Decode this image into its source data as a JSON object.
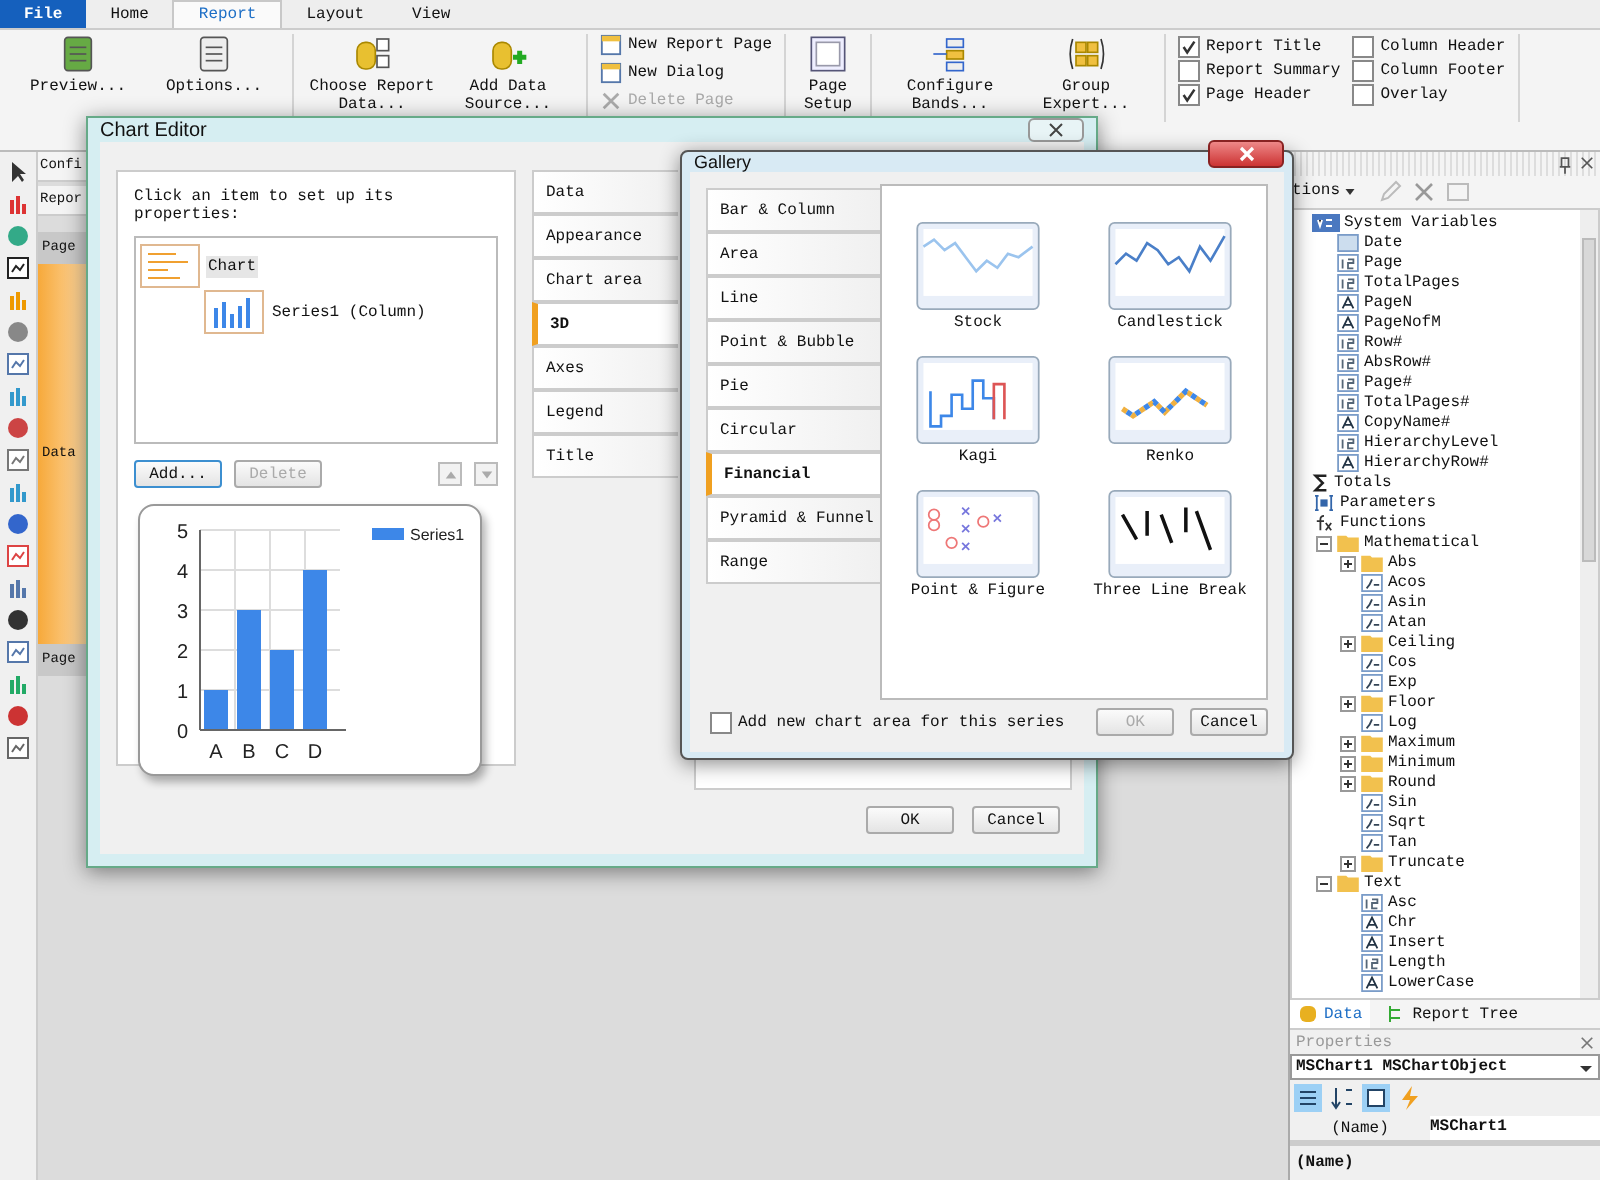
{
  "menu_tabs": [
    {
      "label": "File",
      "kind": "file",
      "selected": false
    },
    {
      "label": "Home",
      "kind": "tab",
      "selected": false
    },
    {
      "label": "Report",
      "kind": "tab",
      "selected": true
    },
    {
      "label": "Layout",
      "kind": "tab",
      "selected": false
    },
    {
      "label": "View",
      "kind": "tab",
      "selected": false
    }
  ],
  "ribbon": [
    {
      "kind": "large",
      "buttons": [
        {
          "label": "Preview...",
          "disabled": false
        },
        {
          "label": "Options...",
          "disabled": false
        }
      ]
    },
    {
      "kind": "large",
      "buttons": [
        {
          "label": "Choose Report Data...",
          "disabled": false
        },
        {
          "label": "Add Data Source...",
          "disabled": false
        }
      ]
    },
    {
      "kind": "small",
      "buttons": [
        {
          "label": "New Report Page",
          "disabled": false
        },
        {
          "label": "New Dialog",
          "disabled": false
        },
        {
          "label": "Delete Page",
          "disabled": true
        }
      ]
    },
    {
      "kind": "large",
      "buttons": [
        {
          "label": "Page Setup",
          "disabled": false
        }
      ]
    },
    {
      "kind": "large",
      "buttons": [
        {
          "label": "Configure Bands...",
          "disabled": false
        },
        {
          "label": "Group Expert...",
          "disabled": false
        }
      ]
    },
    {
      "kind": "checks",
      "buttons": [
        {
          "label": "Report Title",
          "checked": true
        },
        {
          "label": "Report Summary",
          "checked": false
        },
        {
          "label": "Page Header",
          "checked": true
        },
        {
          "label": "Column Header",
          "checked": false
        },
        {
          "label": "Column Footer",
          "checked": false
        },
        {
          "label": "Overlay",
          "checked": false
        }
      ]
    }
  ],
  "designer_tabs": [
    "Confi",
    "Repor"
  ],
  "bands": [
    {
      "label": "Page",
      "kind": "header"
    },
    {
      "label": "Data",
      "kind": "data"
    },
    {
      "label": "Page",
      "kind": "footer"
    }
  ],
  "data_panel": {
    "toolbar_label": "tions",
    "tree": [
      {
        "label": "System Variables",
        "kind": "sysvars",
        "children": [
          {
            "label": "Date",
            "kind": "date"
          },
          {
            "label": "Page",
            "kind": "number"
          },
          {
            "label": "TotalPages",
            "kind": "number"
          },
          {
            "label": "PageN",
            "kind": "text"
          },
          {
            "label": "PageNofM",
            "kind": "text"
          },
          {
            "label": "Row#",
            "kind": "number"
          },
          {
            "label": "AbsRow#",
            "kind": "number"
          },
          {
            "label": "Page#",
            "kind": "number"
          },
          {
            "label": "TotalPages#",
            "kind": "number"
          },
          {
            "label": "CopyName#",
            "kind": "text"
          },
          {
            "label": "HierarchyLevel",
            "kind": "number"
          },
          {
            "label": "HierarchyRow#",
            "kind": "text"
          }
        ]
      },
      {
        "label": "Totals",
        "kind": "totals"
      },
      {
        "label": "Parameters",
        "kind": "parameters"
      },
      {
        "label": "Functions",
        "kind": "functions",
        "children": [
          {
            "label": "Mathematical",
            "kind": "folder",
            "expanded": true,
            "children": [
              {
                "label": "Abs",
                "kind": "folder",
                "expanded": false
              },
              {
                "label": "Acos",
                "kind": "function"
              },
              {
                "label": "Asin",
                "kind": "function"
              },
              {
                "label": "Atan",
                "kind": "function"
              },
              {
                "label": "Ceiling",
                "kind": "folder",
                "expanded": false
              },
              {
                "label": "Cos",
                "kind": "function"
              },
              {
                "label": "Exp",
                "kind": "function"
              },
              {
                "label": "Floor",
                "kind": "folder",
                "expanded": false
              },
              {
                "label": "Log",
                "kind": "function"
              },
              {
                "label": "Maximum",
                "kind": "folder",
                "expanded": false
              },
              {
                "label": "Minimum",
                "kind": "folder",
                "expanded": false
              },
              {
                "label": "Round",
                "kind": "folder",
                "expanded": false
              },
              {
                "label": "Sin",
                "kind": "function"
              },
              {
                "label": "Sqrt",
                "kind": "function"
              },
              {
                "label": "Tan",
                "kind": "function"
              },
              {
                "label": "Truncate",
                "kind": "folder",
                "expanded": false
              }
            ]
          },
          {
            "label": "Text",
            "kind": "folder",
            "expanded": true,
            "children": [
              {
                "label": "Asc",
                "kind": "number"
              },
              {
                "label": "Chr",
                "kind": "text"
              },
              {
                "label": "Insert",
                "kind": "text"
              },
              {
                "label": "Length",
                "kind": "number"
              },
              {
                "label": "LowerCase",
                "kind": "text"
              }
            ]
          }
        ]
      }
    ],
    "tabs": [
      {
        "label": "Data",
        "selected": true
      },
      {
        "label": "Report Tree",
        "selected": false
      }
    ]
  },
  "properties": {
    "title": "Properties",
    "object": "MSChart1 MSChartObject",
    "rows": [
      {
        "name": "(Name)",
        "value": "MSChart1"
      }
    ],
    "description": "(Name)"
  },
  "chart_editor": {
    "title": "Chart Editor",
    "hint": "Click an item to set up its properties:",
    "items": [
      {
        "label": "Chart",
        "selected": true
      },
      {
        "label": "Series1 (Column)",
        "selected": false
      }
    ],
    "buttons": [
      {
        "label": "Add...",
        "disabled": false
      },
      {
        "label": "Delete",
        "disabled": true
      }
    ],
    "move_buttons": [
      {
        "disabled": true
      },
      {
        "disabled": true
      }
    ],
    "chart_data": {
      "type": "bar",
      "categories": [
        "A",
        "B",
        "C",
        "D"
      ],
      "series": [
        {
          "name": "Series1",
          "color": "#3d87e8",
          "values": [
            1,
            3,
            2,
            4
          ]
        }
      ],
      "ylim": [
        0,
        5
      ],
      "grid": true,
      "yticks": [
        0,
        1,
        2,
        3,
        4,
        5
      ]
    },
    "tabs": [
      {
        "label": "Data",
        "selected": false
      },
      {
        "label": "Appearance",
        "selected": false
      },
      {
        "label": "Chart area",
        "selected": false
      },
      {
        "label": "3D",
        "selected": true
      },
      {
        "label": "Axes",
        "selected": false
      },
      {
        "label": "Legend",
        "selected": false
      },
      {
        "label": "Title",
        "selected": false
      }
    ],
    "footer_buttons": [
      {
        "label": "OK",
        "disabled": false
      },
      {
        "label": "Cancel",
        "disabled": false
      }
    ]
  },
  "gallery": {
    "title": "Gallery",
    "categories": [
      {
        "label": "Bar & Column",
        "selected": false
      },
      {
        "label": "Area",
        "selected": false
      },
      {
        "label": "Line",
        "selected": false
      },
      {
        "label": "Point & Bubble",
        "selected": false
      },
      {
        "label": "Pie",
        "selected": false
      },
      {
        "label": "Circular",
        "selected": false
      },
      {
        "label": "Financial",
        "selected": true
      },
      {
        "label": "Pyramid & Funnel",
        "selected": false
      },
      {
        "label": "Range",
        "selected": false
      }
    ],
    "charts": [
      {
        "label": "Stock"
      },
      {
        "label": "Candlestick"
      },
      {
        "label": "Kagi"
      },
      {
        "label": "Renko"
      },
      {
        "label": "Point & Figure"
      },
      {
        "label": "Three Line Break"
      }
    ],
    "new_area": {
      "label": "Add new chart area for this series",
      "checked": false
    },
    "buttons": [
      {
        "label": "OK",
        "disabled": true
      },
      {
        "label": "Cancel",
        "disabled": false
      }
    ]
  }
}
